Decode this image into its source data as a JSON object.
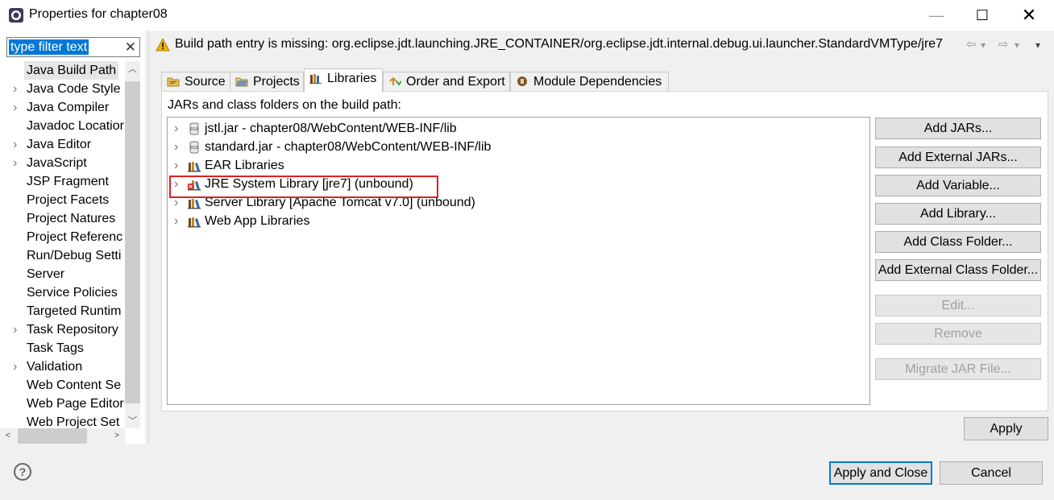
{
  "window": {
    "title": "Properties for chapter08",
    "min_glyph": "—",
    "max_glyph": "☐",
    "close_glyph": "✕"
  },
  "filter": {
    "value": "type filter text",
    "clear_glyph": "✕"
  },
  "tree": {
    "items": [
      {
        "label": "Java Build Path",
        "expandable": false,
        "selected": true
      },
      {
        "label": "Java Code Style",
        "expandable": true
      },
      {
        "label": "Java Compiler",
        "expandable": true
      },
      {
        "label": "Javadoc Locatior",
        "expandable": false
      },
      {
        "label": "Java Editor",
        "expandable": true
      },
      {
        "label": "JavaScript",
        "expandable": true
      },
      {
        "label": "JSP Fragment",
        "expandable": false
      },
      {
        "label": "Project Facets",
        "expandable": false
      },
      {
        "label": "Project Natures",
        "expandable": false
      },
      {
        "label": "Project Referenc",
        "expandable": false
      },
      {
        "label": "Run/Debug Setti",
        "expandable": false
      },
      {
        "label": "Server",
        "expandable": false
      },
      {
        "label": "Service Policies",
        "expandable": false
      },
      {
        "label": "Targeted Runtim",
        "expandable": false
      },
      {
        "label": "Task Repository",
        "expandable": true
      },
      {
        "label": "Task Tags",
        "expandable": false
      },
      {
        "label": "Validation",
        "expandable": true
      },
      {
        "label": "Web Content Se",
        "expandable": false
      },
      {
        "label": "Web Page Editor",
        "expandable": false
      },
      {
        "label": "Web Project Set",
        "expandable": false
      }
    ]
  },
  "header": {
    "message": "Build path entry is missing: org.eclipse.jdt.launching.JRE_CONTAINER/org.eclipse.jdt.internal.debug.ui.launcher.StandardVMType/jre7",
    "back_glyph": "⇦",
    "forward_glyph": "⇨",
    "dropdown_glyph": "▾",
    "menu_glyph": "▾"
  },
  "tabs": [
    {
      "label": "Source",
      "icon": "source-folder-icon"
    },
    {
      "label": "Projects",
      "icon": "projects-icon"
    },
    {
      "label": "Libraries",
      "icon": "libraries-icon",
      "active": true
    },
    {
      "label": "Order and Export",
      "icon": "order-export-icon"
    },
    {
      "label": "Module Dependencies",
      "icon": "module-dependencies-icon"
    }
  ],
  "libraries": {
    "label": "JARs and class folders on the build path:",
    "entries": [
      {
        "label": "jstl.jar - chapter08/WebContent/WEB-INF/lib",
        "icon": "jar-icon"
      },
      {
        "label": "standard.jar - chapter08/WebContent/WEB-INF/lib",
        "icon": "jar-icon"
      },
      {
        "label": "EAR Libraries",
        "icon": "library-icon"
      },
      {
        "label": "JRE System Library [jre7] (unbound)",
        "icon": "library-error-icon",
        "highlighted": true
      },
      {
        "label": "Server Library [Apache Tomcat v7.0] (unbound)",
        "icon": "library-icon"
      },
      {
        "label": "Web App Libraries",
        "icon": "library-icon"
      }
    ]
  },
  "buttons": {
    "add_jars": "Add JARs...",
    "add_external_jars": "Add External JARs...",
    "add_variable": "Add Variable...",
    "add_library": "Add Library...",
    "add_class_folder": "Add Class Folder...",
    "add_external_class_folder": "Add External Class Folder...",
    "edit": "Edit...",
    "remove": "Remove",
    "migrate_jar": "Migrate JAR File...",
    "apply": "Apply",
    "apply_and_close": "Apply and Close",
    "cancel": "Cancel",
    "help": "?"
  },
  "colors": {
    "selection": "#0078d7",
    "highlight_border": "#e02020",
    "warning": "#f0b400"
  }
}
